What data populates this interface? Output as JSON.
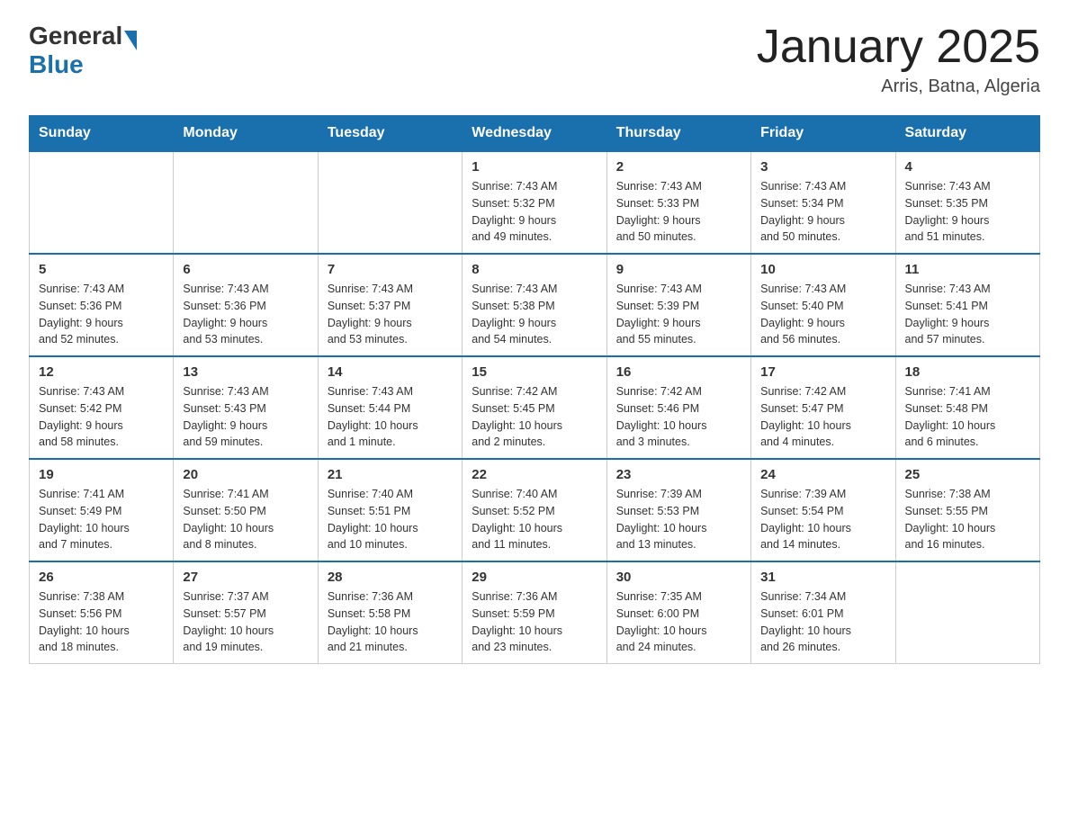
{
  "header": {
    "logo_general": "General",
    "logo_blue": "Blue",
    "month_title": "January 2025",
    "location": "Arris, Batna, Algeria"
  },
  "weekdays": [
    "Sunday",
    "Monday",
    "Tuesday",
    "Wednesday",
    "Thursday",
    "Friday",
    "Saturday"
  ],
  "weeks": [
    [
      {
        "day": "",
        "info": ""
      },
      {
        "day": "",
        "info": ""
      },
      {
        "day": "",
        "info": ""
      },
      {
        "day": "1",
        "info": "Sunrise: 7:43 AM\nSunset: 5:32 PM\nDaylight: 9 hours\nand 49 minutes."
      },
      {
        "day": "2",
        "info": "Sunrise: 7:43 AM\nSunset: 5:33 PM\nDaylight: 9 hours\nand 50 minutes."
      },
      {
        "day": "3",
        "info": "Sunrise: 7:43 AM\nSunset: 5:34 PM\nDaylight: 9 hours\nand 50 minutes."
      },
      {
        "day": "4",
        "info": "Sunrise: 7:43 AM\nSunset: 5:35 PM\nDaylight: 9 hours\nand 51 minutes."
      }
    ],
    [
      {
        "day": "5",
        "info": "Sunrise: 7:43 AM\nSunset: 5:36 PM\nDaylight: 9 hours\nand 52 minutes."
      },
      {
        "day": "6",
        "info": "Sunrise: 7:43 AM\nSunset: 5:36 PM\nDaylight: 9 hours\nand 53 minutes."
      },
      {
        "day": "7",
        "info": "Sunrise: 7:43 AM\nSunset: 5:37 PM\nDaylight: 9 hours\nand 53 minutes."
      },
      {
        "day": "8",
        "info": "Sunrise: 7:43 AM\nSunset: 5:38 PM\nDaylight: 9 hours\nand 54 minutes."
      },
      {
        "day": "9",
        "info": "Sunrise: 7:43 AM\nSunset: 5:39 PM\nDaylight: 9 hours\nand 55 minutes."
      },
      {
        "day": "10",
        "info": "Sunrise: 7:43 AM\nSunset: 5:40 PM\nDaylight: 9 hours\nand 56 minutes."
      },
      {
        "day": "11",
        "info": "Sunrise: 7:43 AM\nSunset: 5:41 PM\nDaylight: 9 hours\nand 57 minutes."
      }
    ],
    [
      {
        "day": "12",
        "info": "Sunrise: 7:43 AM\nSunset: 5:42 PM\nDaylight: 9 hours\nand 58 minutes."
      },
      {
        "day": "13",
        "info": "Sunrise: 7:43 AM\nSunset: 5:43 PM\nDaylight: 9 hours\nand 59 minutes."
      },
      {
        "day": "14",
        "info": "Sunrise: 7:43 AM\nSunset: 5:44 PM\nDaylight: 10 hours\nand 1 minute."
      },
      {
        "day": "15",
        "info": "Sunrise: 7:42 AM\nSunset: 5:45 PM\nDaylight: 10 hours\nand 2 minutes."
      },
      {
        "day": "16",
        "info": "Sunrise: 7:42 AM\nSunset: 5:46 PM\nDaylight: 10 hours\nand 3 minutes."
      },
      {
        "day": "17",
        "info": "Sunrise: 7:42 AM\nSunset: 5:47 PM\nDaylight: 10 hours\nand 4 minutes."
      },
      {
        "day": "18",
        "info": "Sunrise: 7:41 AM\nSunset: 5:48 PM\nDaylight: 10 hours\nand 6 minutes."
      }
    ],
    [
      {
        "day": "19",
        "info": "Sunrise: 7:41 AM\nSunset: 5:49 PM\nDaylight: 10 hours\nand 7 minutes."
      },
      {
        "day": "20",
        "info": "Sunrise: 7:41 AM\nSunset: 5:50 PM\nDaylight: 10 hours\nand 8 minutes."
      },
      {
        "day": "21",
        "info": "Sunrise: 7:40 AM\nSunset: 5:51 PM\nDaylight: 10 hours\nand 10 minutes."
      },
      {
        "day": "22",
        "info": "Sunrise: 7:40 AM\nSunset: 5:52 PM\nDaylight: 10 hours\nand 11 minutes."
      },
      {
        "day": "23",
        "info": "Sunrise: 7:39 AM\nSunset: 5:53 PM\nDaylight: 10 hours\nand 13 minutes."
      },
      {
        "day": "24",
        "info": "Sunrise: 7:39 AM\nSunset: 5:54 PM\nDaylight: 10 hours\nand 14 minutes."
      },
      {
        "day": "25",
        "info": "Sunrise: 7:38 AM\nSunset: 5:55 PM\nDaylight: 10 hours\nand 16 minutes."
      }
    ],
    [
      {
        "day": "26",
        "info": "Sunrise: 7:38 AM\nSunset: 5:56 PM\nDaylight: 10 hours\nand 18 minutes."
      },
      {
        "day": "27",
        "info": "Sunrise: 7:37 AM\nSunset: 5:57 PM\nDaylight: 10 hours\nand 19 minutes."
      },
      {
        "day": "28",
        "info": "Sunrise: 7:36 AM\nSunset: 5:58 PM\nDaylight: 10 hours\nand 21 minutes."
      },
      {
        "day": "29",
        "info": "Sunrise: 7:36 AM\nSunset: 5:59 PM\nDaylight: 10 hours\nand 23 minutes."
      },
      {
        "day": "30",
        "info": "Sunrise: 7:35 AM\nSunset: 6:00 PM\nDaylight: 10 hours\nand 24 minutes."
      },
      {
        "day": "31",
        "info": "Sunrise: 7:34 AM\nSunset: 6:01 PM\nDaylight: 10 hours\nand 26 minutes."
      },
      {
        "day": "",
        "info": ""
      }
    ]
  ]
}
